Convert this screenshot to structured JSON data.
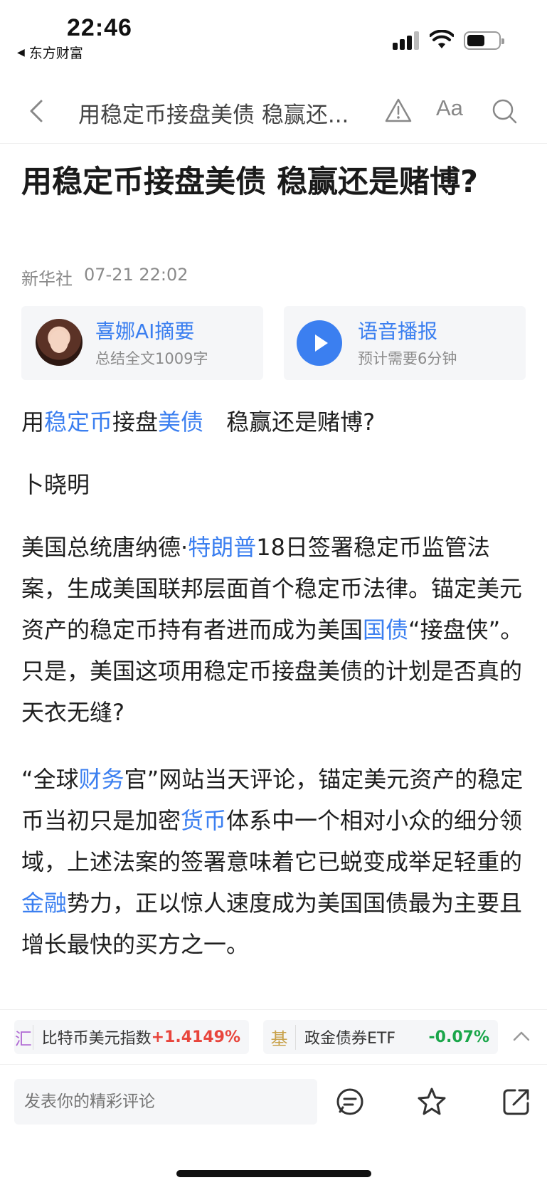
{
  "status": {
    "time": "22:46",
    "back_app": "东方财富"
  },
  "nav": {
    "title": "用稳定币接盘美债 稳赢还...",
    "font_label": "Aa"
  },
  "article": {
    "headline": "用稳定币接盘美债 稳赢还是赌博?",
    "source": "新华社",
    "datetime": "07-21 22:02",
    "summary_card": {
      "title": "喜娜AI摘要",
      "subtitle": "总结全文1009字"
    },
    "audio_card": {
      "title": "语音播报",
      "subtitle": "预计需要6分钟"
    },
    "p1": {
      "a": "用",
      "l1": "稳定币",
      "b": "接盘",
      "l2": "美债",
      "c": "　稳赢还是赌博?"
    },
    "p2": "卜晓明",
    "p3": {
      "a": "美国总统唐纳德·",
      "l1": "特朗普",
      "b": "18日签署稳定币监管法案，生成美国联邦层面首个稳定币法律。锚定美元资产的稳定币持有者进而成为美国",
      "l2": "国债",
      "c": "“接盘侠”。只是，美国这项用稳定币接盘美债的计划是否真的天衣无缝?"
    },
    "p4": {
      "a": "“全球",
      "l1": "财务",
      "b": "官”网站当天评论，锚定美元资产的稳定币当初只是加密",
      "l2": "货币",
      "c": "体系中一个相对小众的细分领域，上述法案的签署意味着它已蜕变成举足轻重的",
      "l3": "金融",
      "d": "势力，正以惊人速度成为美国国债最为主要且增长最快的买方之一。"
    }
  },
  "tickers": [
    {
      "icon": "汇",
      "name": "比特币美元指数",
      "change": "+1.4149%"
    },
    {
      "icon": "基",
      "name": "政金债券ETF",
      "change": "-0.07%"
    }
  ],
  "bottom": {
    "comment_placeholder": "发表你的精彩评论"
  },
  "colors": {
    "link": "#3b7ff0",
    "up": "#e8453c",
    "down": "#1aa64a"
  }
}
